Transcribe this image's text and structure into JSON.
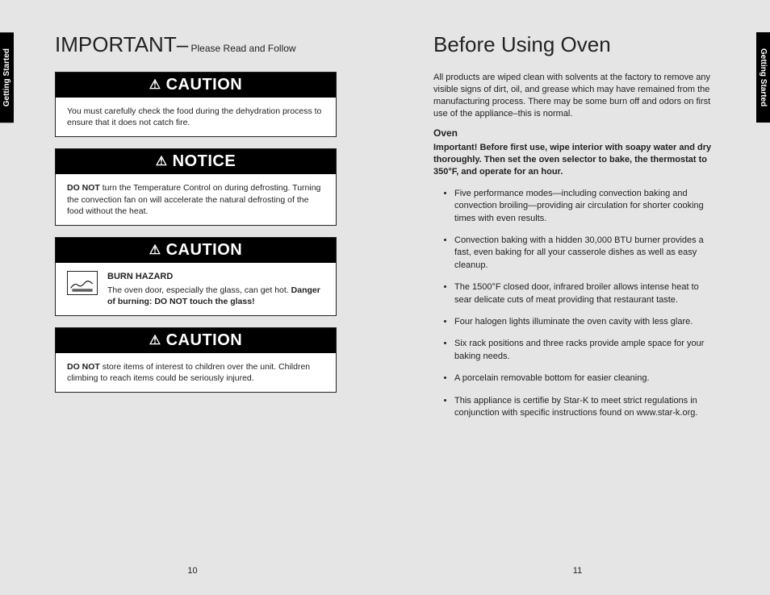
{
  "sideTabLeft": "Getting Started",
  "sideTabRight": "Getting Started",
  "left": {
    "headingMain": "IMPORTANT–",
    "headingSub": " Please Read and Follow",
    "alerts": [
      {
        "header": "CAUTION",
        "body": "You must carefully check the food during the dehydration process to ensure that it does not catch fire."
      },
      {
        "header": "NOTICE",
        "body_prefix_bold": "DO NOT",
        "body_rest": " turn the Temperature Control on during defrosting. Turning the convection fan on will accelerate the natural defrosting of the food without the heat."
      },
      {
        "header": "CAUTION",
        "hazard_title": "BURN HAZARD",
        "hazard_text_a": "The oven door, especially the glass, can get hot. ",
        "hazard_text_b": "Danger of burning: DO NOT touch the glass!"
      },
      {
        "header": "CAUTION",
        "body_prefix_bold": "DO NOT",
        "body_rest": " store items of interest to children over the unit. Children climbing to reach items could be seriously injured."
      }
    ],
    "pageNum": "10"
  },
  "right": {
    "heading": "Before Using Oven",
    "intro": "All products are wiped clean with solvents at the factory to remove any visible signs of dirt, oil, and grease which may have remained from the manufacturing process. There may be some burn off and odors on first use of the appliance–this is normal.",
    "subhead": "Oven",
    "important": "Important! Before first use, wipe interior with soapy water and dry thoroughly. Then set the oven selector to bake, the thermostat to 350°F, and operate for an hour.",
    "features": [
      "Five performance modes—including convection baking and convection broiling—providing air circulation for shorter cooking times with even results.",
      "Convection baking with a hidden 30,000 BTU burner provides a fast, even baking for all your casserole dishes as well as easy cleanup.",
      "The 1500°F closed door, infrared broiler allows intense heat to sear delicate cuts of meat providing that restaurant taste.",
      "Four halogen lights illuminate the oven cavity with less glare.",
      "Six rack positions and three racks provide ample space for your baking needs.",
      "A porcelain removable bottom for easier cleaning.",
      "This appliance is certifie by Star-K to meet strict regulations in conjunction with specific instructions found on www.star-k.org."
    ],
    "pageNum": "11"
  }
}
